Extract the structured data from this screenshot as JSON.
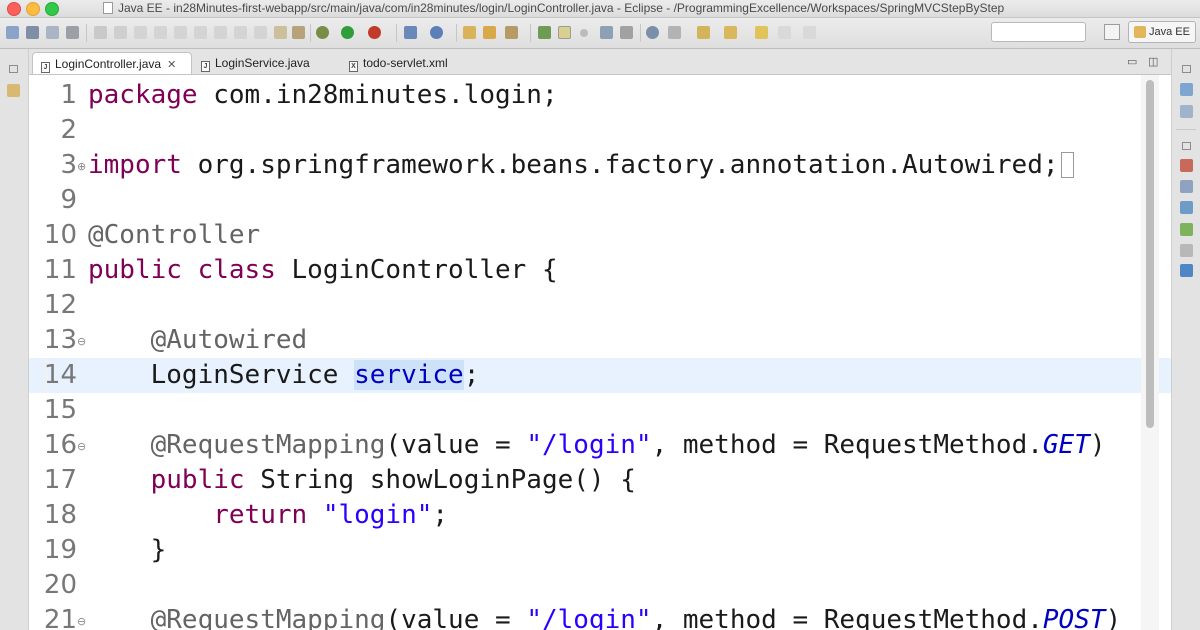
{
  "window": {
    "title": "Java EE - in28Minutes-first-webapp/src/main/java/com/in28minutes/login/LoginController.java - Eclipse - /ProgrammingExcellence/Workspaces/SpringMVCStepByStep"
  },
  "toolbar": {
    "search_value": "",
    "perspective_label": "Java EE"
  },
  "tabs": [
    {
      "label": "LoginController.java",
      "icon": "java-file-icon",
      "active": true
    },
    {
      "label": "LoginService.java",
      "icon": "java-file-icon",
      "active": false
    },
    {
      "label": "todo-servlet.xml",
      "icon": "xml-file-icon",
      "active": false
    }
  ],
  "editor": {
    "lines": [
      {
        "num": "1",
        "fold": "",
        "tokens": [
          [
            "kw",
            "package"
          ],
          [
            "",
            "com.in28minutes.login;"
          ]
        ]
      },
      {
        "num": "2",
        "fold": "",
        "tokens": []
      },
      {
        "num": "3",
        "fold": "+",
        "tokens": [
          [
            "kw",
            "import"
          ],
          [
            "",
            "org.springframework.beans.factory.annotation.Autowired;"
          ]
        ],
        "collapsed": true
      },
      {
        "num": "9",
        "fold": "",
        "tokens": []
      },
      {
        "num": "10",
        "fold": "",
        "tokens": [
          [
            "ann",
            "@Controller"
          ]
        ]
      },
      {
        "num": "11",
        "fold": "",
        "tokens": [
          [
            "kw",
            "public"
          ],
          [
            "",
            " "
          ],
          [
            "kw",
            "class"
          ],
          [
            "",
            " LoginController {"
          ]
        ]
      },
      {
        "num": "12",
        "fold": "",
        "tokens": []
      },
      {
        "num": "13",
        "fold": "-",
        "tokens": [
          [
            "",
            "    "
          ],
          [
            "ann",
            "@Autowired"
          ]
        ]
      },
      {
        "num": "14",
        "fold": "",
        "current": true,
        "tokens": [
          [
            "",
            "    LoginService "
          ],
          [
            "field occ",
            "service"
          ],
          [
            "",
            ";"
          ]
        ]
      },
      {
        "num": "15",
        "fold": "",
        "tokens": []
      },
      {
        "num": "16",
        "fold": "-",
        "tokens": [
          [
            "",
            "    "
          ],
          [
            "ann",
            "@RequestMapping"
          ],
          [
            "",
            "(value = "
          ],
          [
            "str",
            "\"/login\""
          ],
          [
            "",
            ", method = RequestMethod."
          ],
          [
            "const",
            "GET"
          ],
          [
            "",
            ")"
          ]
        ]
      },
      {
        "num": "17",
        "fold": "",
        "tokens": [
          [
            "",
            "    "
          ],
          [
            "kw",
            "public"
          ],
          [
            "",
            " String showLoginPage() {"
          ]
        ]
      },
      {
        "num": "18",
        "fold": "",
        "tokens": [
          [
            "",
            "        "
          ],
          [
            "kw",
            "return"
          ],
          [
            "",
            " "
          ],
          [
            "str",
            "\"login\""
          ],
          [
            "",
            ";"
          ]
        ]
      },
      {
        "num": "19",
        "fold": "",
        "tokens": [
          [
            "",
            "    }"
          ]
        ]
      },
      {
        "num": "20",
        "fold": "",
        "tokens": []
      },
      {
        "num": "21",
        "fold": "-",
        "tokens": [
          [
            "",
            "    "
          ],
          [
            "ann",
            "@RequestMapping"
          ],
          [
            "",
            "(value = "
          ],
          [
            "str",
            "\"/login\""
          ],
          [
            "",
            ", method = RequestMethod."
          ],
          [
            "const",
            "POST"
          ],
          [
            "",
            ")"
          ]
        ]
      }
    ]
  },
  "colors": {
    "keyword": "#7f0055",
    "string": "#2a00ff",
    "annotation": "#646464",
    "field": "#0000c0",
    "current_line": "#e8f2fe"
  }
}
